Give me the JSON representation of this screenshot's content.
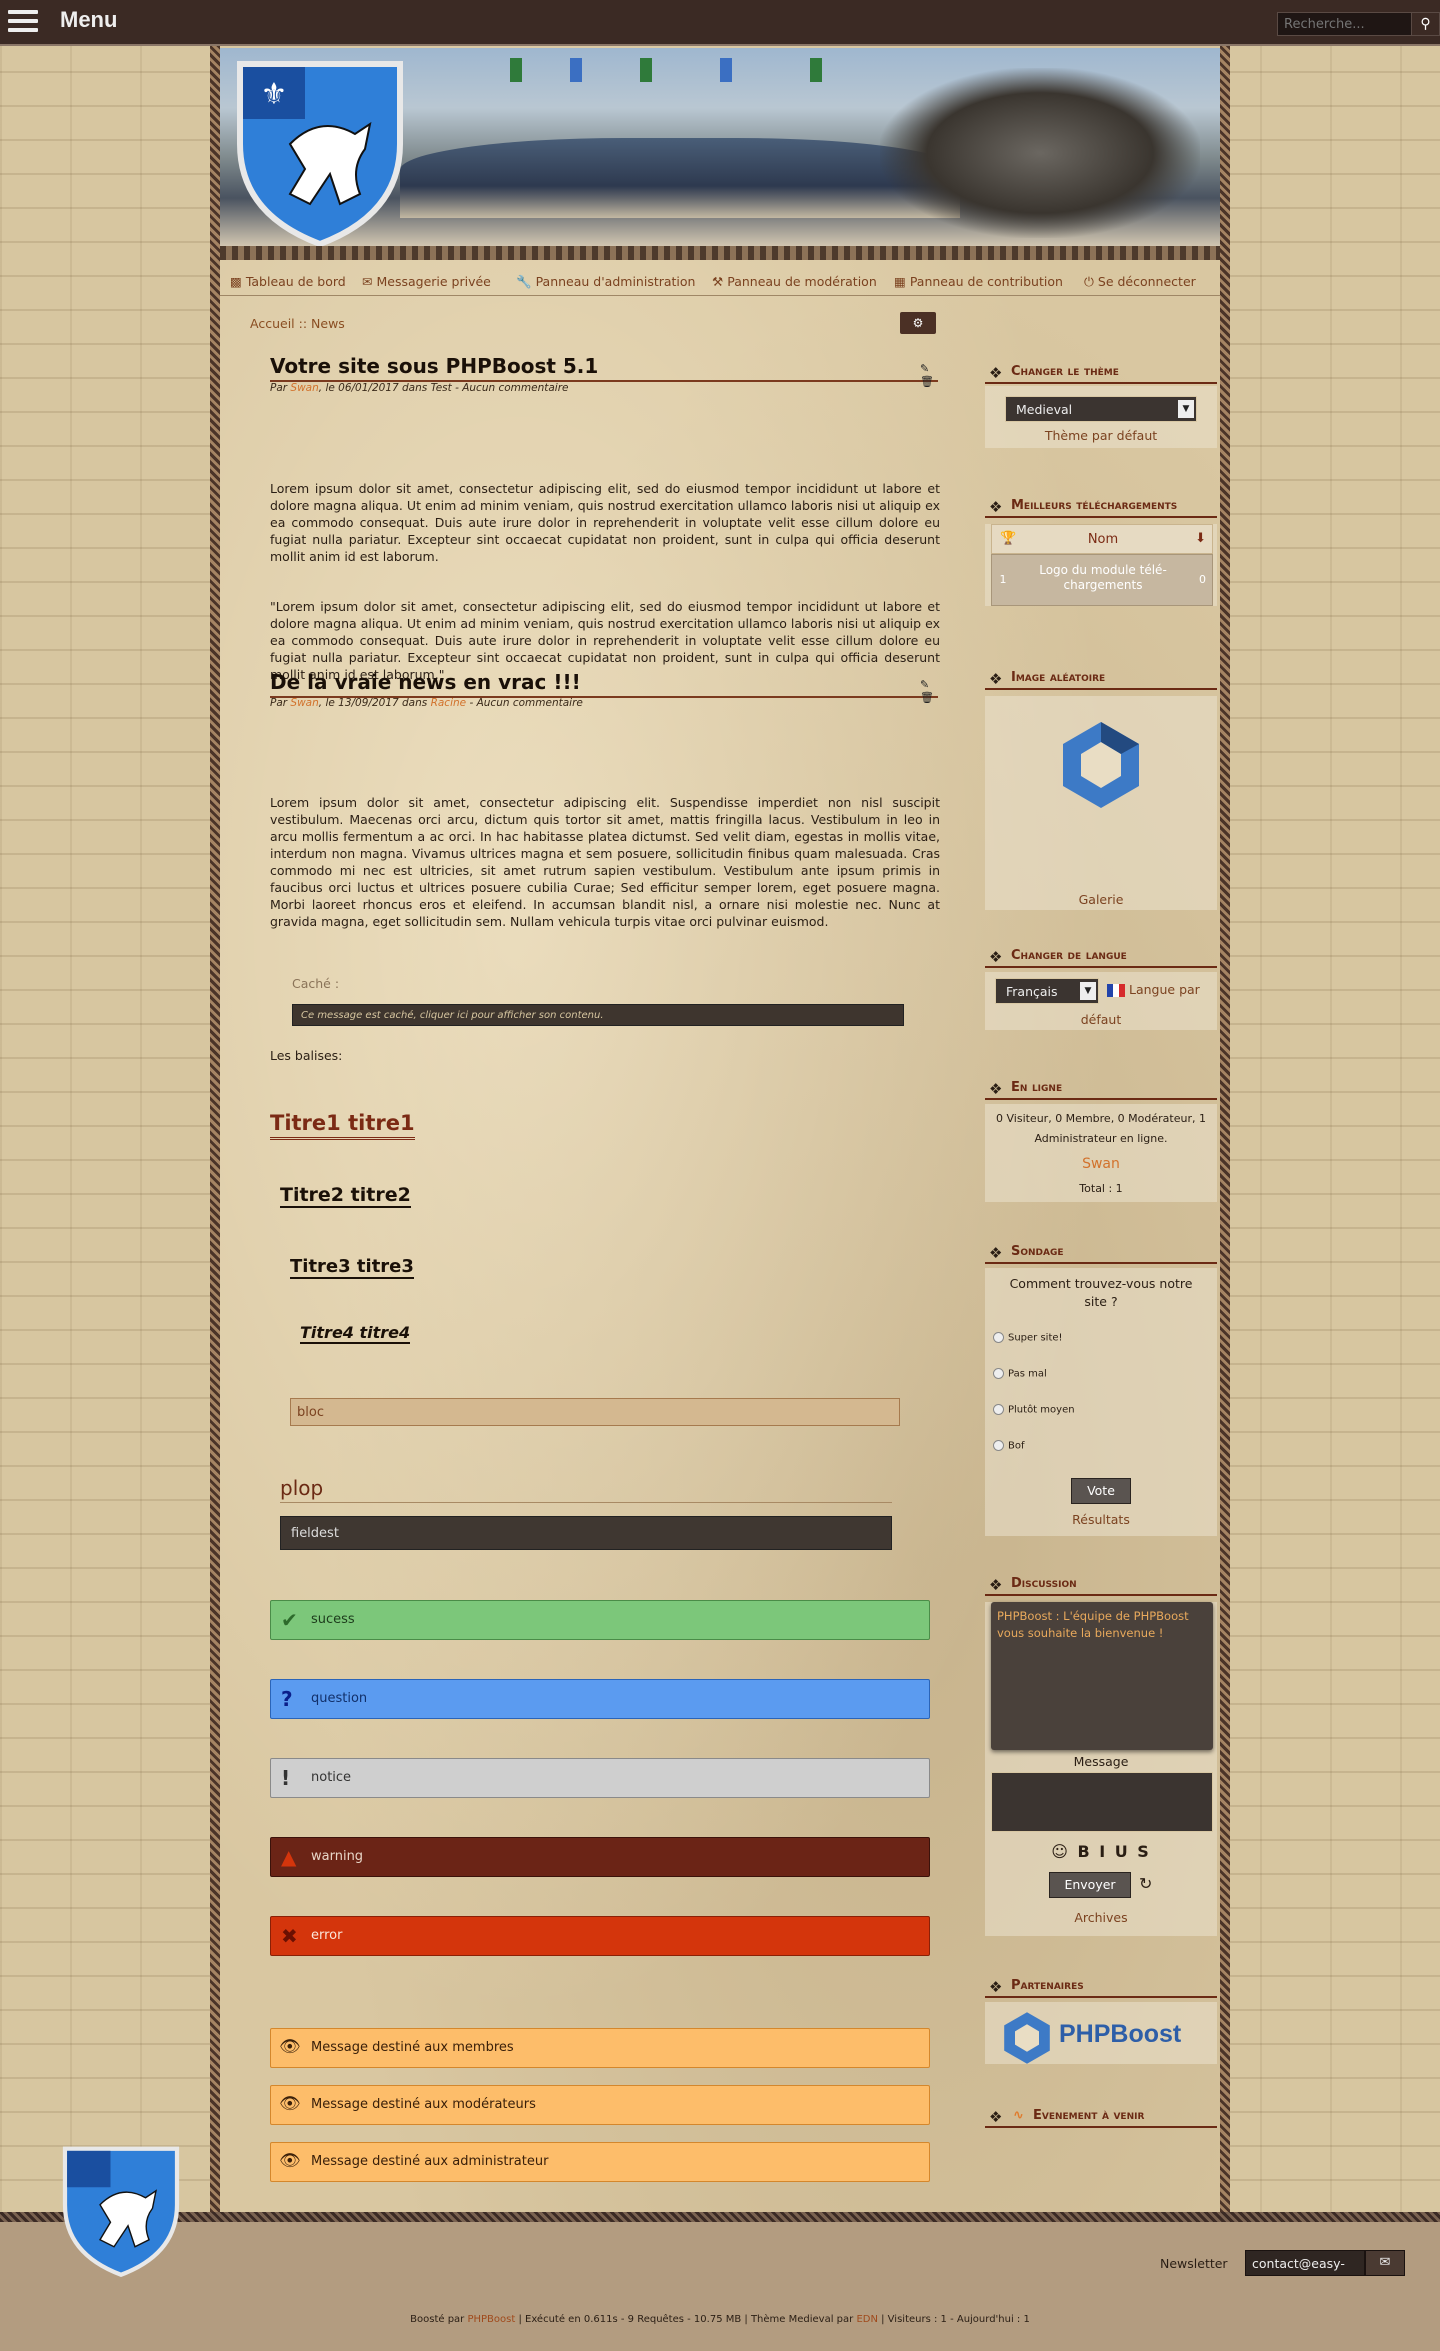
{
  "topbar": {
    "menu_label": "Menu",
    "search_placeholder": "Recherche...",
    "search_icon": "search-icon"
  },
  "nav": {
    "items": [
      {
        "label": "Tableau de bord",
        "icon": "dashboard-icon"
      },
      {
        "label": "Messagerie privée",
        "icon": "envelope-icon"
      },
      {
        "label": "Panneau d'administration",
        "icon": "wrench-icon"
      },
      {
        "label": "Panneau de modération",
        "icon": "gavel-icon"
      },
      {
        "label": "Panneau de contribution",
        "icon": "file-icon"
      },
      {
        "label": "Se déconnecter",
        "icon": "power-icon"
      }
    ]
  },
  "breadcrumb": {
    "home": "Accueil",
    "sep": "::",
    "current": "News"
  },
  "articles": [
    {
      "title": "Votre site sous PHPBoost 5.1",
      "meta_par": "Par ",
      "author": "Swan",
      "meta_mid": ", le 06/01/2017 dans ",
      "category": "Test",
      "meta_end": " - Aucun commentaire",
      "para1": "Lorem ipsum dolor sit amet, consectetur adipiscing elit, sed do eiusmod tempor incididunt ut labore et dolore magna aliqua. Ut enim ad minim veniam, quis nostrud exercitation ullamco laboris nisi ut aliquip ex ea commodo consequat. Duis aute irure dolor in reprehenderit in voluptate velit esse cil­lum dolore eu fugiat nulla pariatur. Excepteur sint occaecat cupidatat non proident, sunt in culpa qui officia deserunt mollit anim id est laborum.",
      "para2": "\"Lorem ipsum dolor sit amet, consectetur adipiscing elit, sed do eiusmod tempor incididunt ut la­bore et dolore magna aliqua. Ut enim ad minim veniam, quis nostrud exercitation ullamco laboris ni­si ut aliquip ex ea commodo consequat. Duis aute irure dolor in reprehenderit in voluptate velit esse cillum dolore eu fugiat nulla pariatur. Excepteur sint occaecat cupidatat non proident, sunt in culpa qui officia deserunt mollit anim id est laborum.\""
    },
    {
      "title": "De la vraie news en vrac !!!",
      "meta_par": "Par ",
      "author": "Swan",
      "meta_mid": ", le 13/09/2017 dans ",
      "category": "Racine",
      "meta_end": " - Aucun commentaire",
      "para1": "Lorem ipsum dolor sit amet, consectetur adipiscing elit. Suspendisse imperdiet non nisl suscipit vestibulum. Maecenas orci arcu, dictum quis tortor sit amet, mattis fringilla lacus. Vestibulum in leo in arcu mollis fermentum a ac orci. In hac habitasse platea dictumst. Sed velit diam, egestas in mollis vitae, interdum non magna. Vivamus ultrices magna et sem posuere, sollicitudin finibus quam malesuada. Cras commodo mi nec est ultricies, sit amet rutrum sapien vestibulum. Vestibulum ante ipsum primis in faucibus orci luctus et ultrices posuere cubilia Curae; Sed efficitur semper lorem, eget posuere magna. Morbi laoreet rhoncus eros et eleifend. In accumsan blandit nisl, a ornare nisi molestie nec. Nunc at gravida magna, eget sollicitudin sem. Nullam vehicula turpis vitae orci pulvi­nar euismod."
    }
  ],
  "hidden": {
    "label": "Caché :",
    "text": "Ce message est caché, cliquer ici pour afficher son contenu."
  },
  "balises_label": "Les balises:",
  "headings": {
    "h1": "Titre1 titre1",
    "h2": "Titre2 titre2",
    "h3": "Titre3 titre3",
    "h4": "Titre4 titre4"
  },
  "bloc": "bloc",
  "fieldset": {
    "legend": "plop",
    "content": "fieldest"
  },
  "messages": {
    "success": "sucess",
    "question": "question",
    "notice": "notice",
    "warning": "warning",
    "error": "error",
    "members": "Message destiné aux membres",
    "moderators": "Message destiné aux modérateurs",
    "admins": "Message destiné aux administrateur"
  },
  "sidebar": {
    "theme": {
      "title": "Changer le thème",
      "selected": "Medieval",
      "default_link": "Thème par défaut"
    },
    "downloads": {
      "title": "Meilleurs téléchargements",
      "col_name": "Nom",
      "row_rank": "1",
      "row_name": "Logo du module télé­chargements",
      "row_count": "0"
    },
    "random_image": {
      "title": "Image aléatoire",
      "link": "Galerie"
    },
    "language": {
      "title": "Changer de langue",
      "selected": "Français",
      "default_link_a": "Langue par",
      "default_link_b": "défaut"
    },
    "online": {
      "title": "En ligne",
      "summary_a": "0 Visiteur, 0 Membre, 0 Modérateur, 1",
      "summary_b": "Administrateur en ligne.",
      "user": "Swan",
      "total": "Total : 1"
    },
    "poll": {
      "title": "Sondage",
      "question_a": "Comment trouvez-vous notre",
      "question_b": "site ?",
      "options": [
        "Super site!",
        "Pas mal",
        "Plutôt moyen",
        "Bof"
      ],
      "vote_btn": "Vote",
      "results": "Résultats"
    },
    "shoutbox": {
      "title": "Discussion",
      "message": "PHPBoost : L'équipe de PHP­Boost vous souhaite la bienve­nue !",
      "msg_label": "Message",
      "format_bar": "☺ B I U S",
      "send_btn": "Envoyer",
      "archives": "Archives"
    },
    "partners": {
      "title": "Partenaires",
      "logo_text": "PHPBoost"
    },
    "events": {
      "title": "Evenement à venir"
    }
  },
  "footer": {
    "newsletter_label": "Newsletter",
    "newsletter_value": "contact@easy-",
    "credits_a": "Boosté par ",
    "credits_php": "PHPBoost",
    "credits_b": " | Exécuté en 0.611s - 9 Requêtes - 10.75 MB | Thème Medieval par ",
    "credits_edn": "EDN",
    "credits_c": " | Visiteurs : 1 - Aujourd'hui : 1"
  },
  "colors": {
    "accent": "#7b4220",
    "dark_brown": "#3b2a24",
    "title_red": "#6b2a14"
  }
}
